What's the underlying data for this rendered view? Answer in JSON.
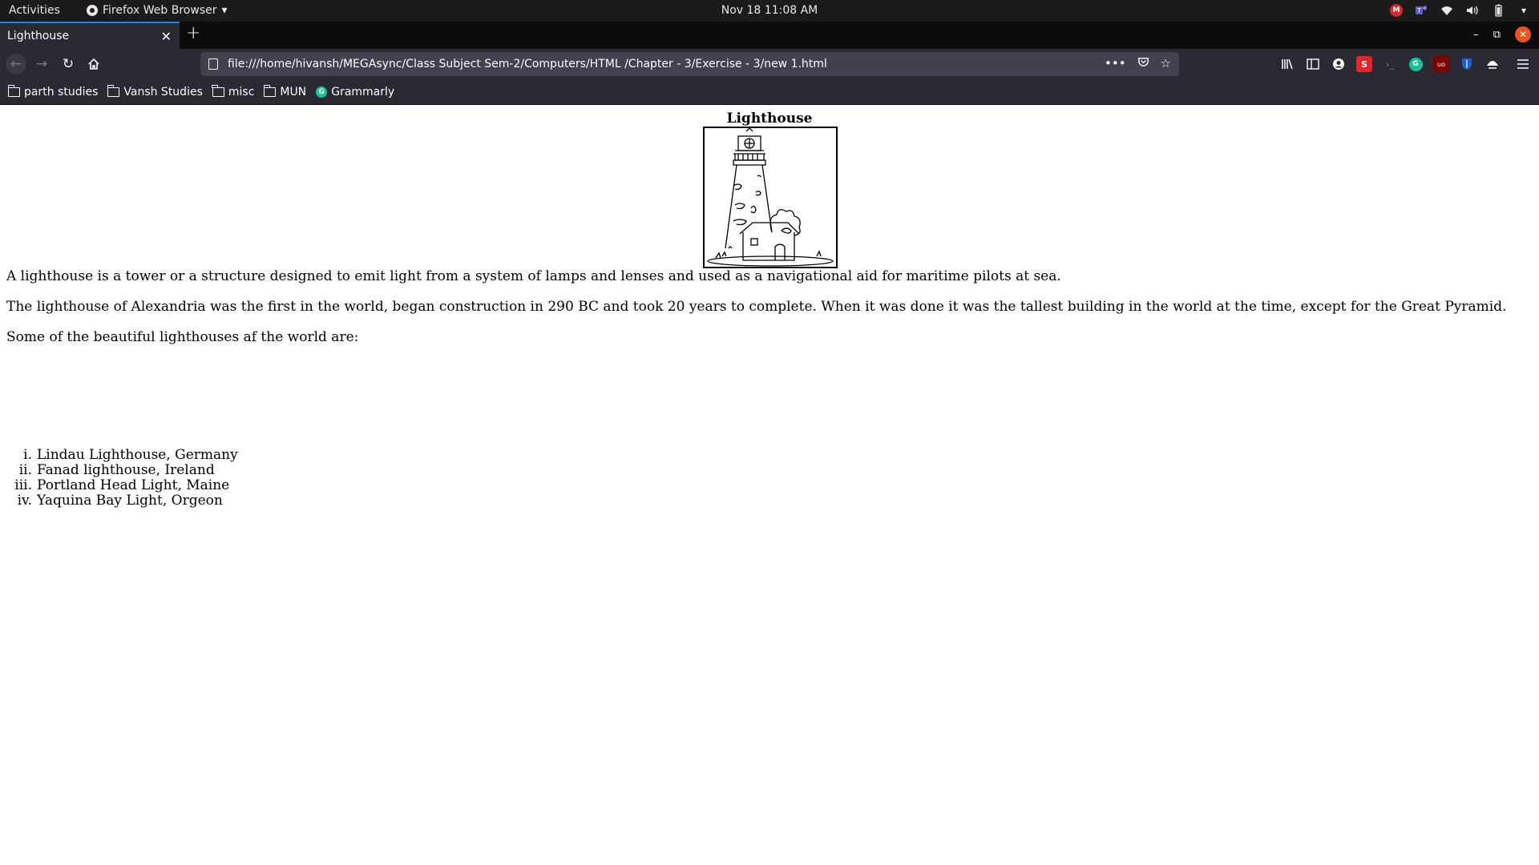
{
  "topbar": {
    "activities": "Activities",
    "app_name": "Firefox Web Browser",
    "clock": "Nov 18  11:08 AM",
    "mega_badge": "M"
  },
  "tab": {
    "title": "Lighthouse"
  },
  "urlbar": {
    "url": "file:///home/hivansh/MEGAsync/Class Subject Sem-2/Computers/HTML /Chapter - 3/Exercise - 3/new 1.html"
  },
  "extensions": {
    "s_badge": "S",
    "ub_badge": "uo"
  },
  "bookmarks": [
    {
      "label": "parth studies",
      "icon": "folder-icon"
    },
    {
      "label": "Vansh Studies",
      "icon": "folder-icon"
    },
    {
      "label": "misc",
      "icon": "folder-icon"
    },
    {
      "label": "MUN",
      "icon": "folder-icon"
    },
    {
      "label": "Grammarly",
      "icon": "grammarly-icon"
    }
  ],
  "content": {
    "caption": "Lighthouse",
    "para1": "A lighthouse is a tower or a structure designed to emit light from a system of lamps and lenses and used as a navigational aid for maritime pilots at sea.",
    "para2": "The lighthouse of Alexandria was the first in the world, began construction in 290 BC and took 20 years to complete. When it was done it was the tallest building in the world at the time, except for the Great Pyramid.",
    "para3": "Some of the beautiful lighthouses af the world are:",
    "list": [
      {
        "num": "i.",
        "text": "Lindau Lighthouse, Germany"
      },
      {
        "num": "ii.",
        "text": "Fanad lighthouse, Ireland"
      },
      {
        "num": "iii.",
        "text": "Portland Head Light, Maine"
      },
      {
        "num": "iv.",
        "text": "Yaquina Bay Light, Orgeon"
      }
    ]
  },
  "colors": {
    "accent": "#0a84ff",
    "toolbar": "#2b2a33",
    "close_button": "#e95420"
  }
}
